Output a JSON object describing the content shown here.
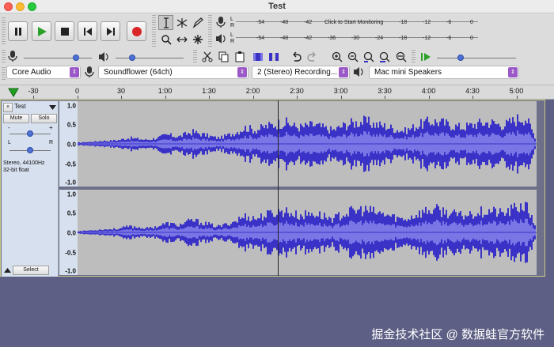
{
  "window": {
    "title": "Test"
  },
  "colors": {
    "wave": "#3a32c7",
    "wave_light": "#7b76e6",
    "track_bg": "#bdbdbd",
    "page_bg": "#5d5f84",
    "record": "#d92626",
    "play": "#2aa12a",
    "combo_arrow": "#9b59c7",
    "play_cursor": "#22a022"
  },
  "meters": {
    "record_scale": [
      "-54",
      "-48",
      "-42",
      "Click to Start Monitoring",
      "-18",
      "-12",
      "-6",
      "0"
    ],
    "playback_scale": [
      "-54",
      "-48",
      "-42",
      "-36",
      "-30",
      "-24",
      "-18",
      "-12",
      "-6",
      "0"
    ],
    "L": "L",
    "R": "R"
  },
  "devices": {
    "host": "Core Audio",
    "input": "Soundflower (64ch)",
    "channels": "2 (Stereo) Recording...",
    "output": "Mac mini Speakers"
  },
  "timeline": [
    "-30",
    "0",
    "30",
    "1:00",
    "1:30",
    "2:00",
    "2:30",
    "3:00",
    "3:30",
    "4:00",
    "4:30",
    "5:00"
  ],
  "track": {
    "name": "Test",
    "close": "×",
    "mute": "Mute",
    "solo": "Solo",
    "gain_minus": "-",
    "gain_plus": "+",
    "pan_left": "L",
    "pan_right": "R",
    "info_line1": "Stereo, 44100Hz",
    "info_line2": "32-bit float",
    "select": "Select",
    "ruler_top": [
      "1.0",
      "0.5",
      "0.0",
      "-0.5",
      "-1.0"
    ],
    "ruler_bottom": [
      "1.0",
      "0.5",
      "0.0",
      "-0.5",
      "-1.0"
    ]
  },
  "amplitude_envelope": [
    0.04,
    0.05,
    0.06,
    0.07,
    0.08,
    0.1,
    0.1,
    0.11,
    0.12,
    0.14,
    0.18,
    0.2,
    0.18,
    0.16,
    0.14,
    0.15,
    0.18,
    0.22,
    0.28,
    0.3,
    0.26,
    0.24,
    0.3,
    0.36,
    0.4,
    0.36,
    0.32,
    0.28,
    0.24,
    0.2,
    0.22,
    0.28,
    0.33,
    0.4,
    0.48,
    0.55,
    0.5,
    0.46,
    0.52,
    0.58,
    0.62,
    0.66,
    0.7,
    0.72,
    0.68,
    0.6,
    0.56,
    0.58,
    0.62,
    0.64,
    0.6,
    0.55,
    0.5,
    0.46,
    0.52,
    0.6,
    0.66,
    0.7,
    0.72,
    0.76,
    0.74,
    0.7,
    0.66,
    0.62,
    0.6,
    0.55,
    0.5,
    0.46,
    0.44,
    0.5,
    0.58,
    0.64,
    0.7,
    0.74,
    0.76,
    0.74,
    0.7,
    0.66,
    0.62,
    0.58,
    0.56,
    0.6,
    0.64,
    0.68,
    0.7,
    0.72,
    0.72,
    0.68,
    0.64,
    0.66,
    0.74,
    0.82,
    0.88,
    0.9,
    0.6,
    0.25
  ],
  "watermark": "掘金技术社区 @ 数据蛙官方软件"
}
